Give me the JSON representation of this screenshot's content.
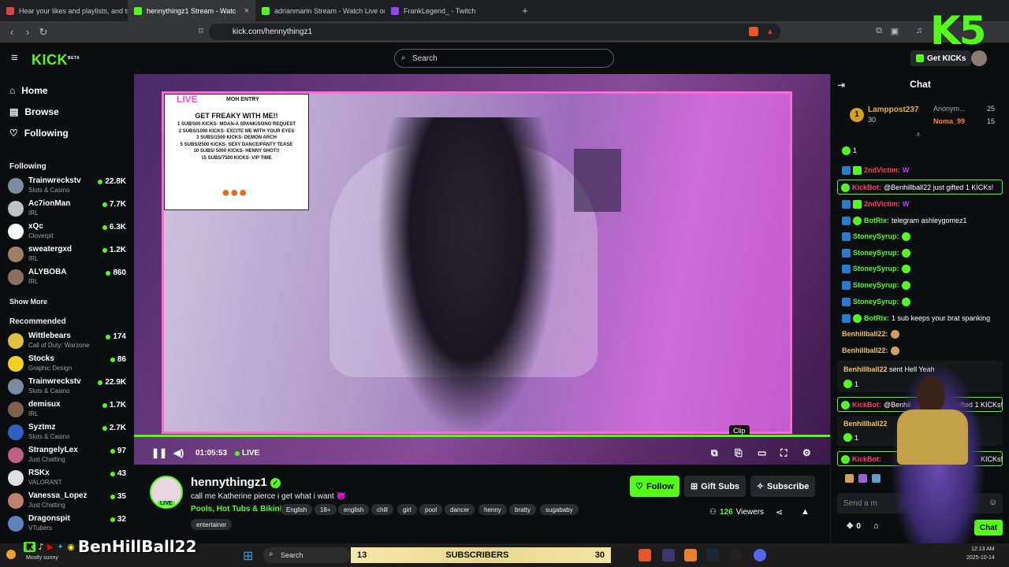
{
  "browser": {
    "tabs": [
      {
        "label": "Hear your likes and playlists, and tra",
        "color": "#d44"
      },
      {
        "label": "hennythingz1 Stream - Watc",
        "color": "#53fc18",
        "active": true
      },
      {
        "label": "adrianmarin Stream - Watch Live on",
        "color": "#53fc18"
      },
      {
        "label": "FrankLegend_ - Twitch",
        "color": "#9146ff"
      }
    ],
    "new_tab": "+",
    "url": "kick.com/hennythingz1"
  },
  "header": {
    "logo": "KICK",
    "logo_beta": "BETA",
    "search_placeholder": "Search",
    "get_kicks": "Get KICKs"
  },
  "sidebar": {
    "nav": [
      "Home",
      "Browse",
      "Following"
    ],
    "following_heading": "Following",
    "following": [
      {
        "name": "Trainwreckstv",
        "category": "Slots & Casino",
        "viewers": "22.8K",
        "color": "#7a8ca0"
      },
      {
        "name": "Ac7ionMan",
        "category": "IRL",
        "viewers": "7.7K",
        "color": "#c0c0c0"
      },
      {
        "name": "xQc",
        "category": "Cloverpit",
        "viewers": "6.3K",
        "color": "#fff"
      },
      {
        "name": "sweatergxd",
        "category": "IRL",
        "viewers": "1.2K",
        "color": "#a08060"
      },
      {
        "name": "ALYBOBA",
        "category": "IRL",
        "viewers": "860",
        "color": "#8a7060"
      }
    ],
    "show_more": "Show More",
    "recommended_heading": "Recommended",
    "recommended": [
      {
        "name": "Wittlebears",
        "category": "Call of Duty: Warzone",
        "viewers": "174",
        "color": "#e0c040"
      },
      {
        "name": "Stocks",
        "category": "Graphic Design",
        "viewers": "86",
        "color": "#f0d020"
      },
      {
        "name": "Trainwreckstv",
        "category": "Slots & Casino",
        "viewers": "22.9K",
        "color": "#7a8ca0"
      },
      {
        "name": "demisux",
        "category": "IRL",
        "viewers": "1.7K",
        "color": "#806050"
      },
      {
        "name": "Syztmz",
        "category": "Slots & Casino",
        "viewers": "2.7K",
        "color": "#3060c0"
      },
      {
        "name": "StrangelyLex",
        "category": "Just Chatting",
        "viewers": "97",
        "color": "#c06080"
      },
      {
        "name": "RSKx",
        "category": "VALORANT",
        "viewers": "43",
        "color": "#e0e0e0"
      },
      {
        "name": "Vanessa_Lopez",
        "category": "Just Chatting",
        "viewers": "35",
        "color": "#c08070"
      },
      {
        "name": "Dragonspit",
        "category": "VTubers",
        "viewers": "32",
        "color": "#6080c0"
      }
    ]
  },
  "player": {
    "live_label": "LIVE",
    "sign_corner": "MOH ENTRY",
    "sign_title": "GET FREAKY WITH ME!!",
    "sign_lines": [
      "1 SUB/500 KICKS- MOAN-A SPANK/SONG REQUEST",
      "2 SUBS/1000 KICKS- EXCITE ME WITH YOUR EYES",
      "3 SUBS/1500 KICKS- DEMON ARCH",
      "5 SUBS/2500 KICKS- SEXY DANCE/PANTY TEASE",
      "10 SUBS/ 5000 KICKS- HENNY SHOT!!",
      "15 SUBS/7500 KICKS- VIP TIME"
    ],
    "time": "01:05:53",
    "live_status": "LIVE",
    "clip_tooltip": "Clip"
  },
  "stream": {
    "name": "hennythingz1",
    "title": "call me Katherine pierce i get what i want 👿",
    "category": "Pools, Hot Tubs & Bikinis",
    "avatar_live": "LIVE",
    "tags": [
      "English",
      "18+",
      "english",
      "chill",
      "girl",
      "pool",
      "dancer",
      "henny",
      "bratty",
      "sugababy",
      "entertainer"
    ],
    "follow": "Follow",
    "gift_subs": "Gift Subs",
    "subscribe": "Subscribe",
    "viewers": "126",
    "viewers_label": "Viewers"
  },
  "chat": {
    "title": "Chat",
    "leader": {
      "name": "Lamppost237",
      "count": "30",
      "rank": "1"
    },
    "leader2": [
      {
        "name": "Anonym...",
        "count": "25"
      },
      {
        "name": "Noma_99",
        "count": "15"
      }
    ],
    "messages": [
      {
        "user": "",
        "text": "1",
        "color": "#fff"
      },
      {
        "user": "2ndVictim:",
        "text": "W",
        "color": "#ff4060"
      },
      {
        "user": "KickBot:",
        "text": "@Benhillball22 just gifted 1 KICKs!",
        "color": "#ff4060",
        "boxed": true
      },
      {
        "user": "2ndVictim:",
        "text": "W",
        "color": "#ff4060"
      },
      {
        "user": "BotRix:",
        "text": "telegram ashleygomez1",
        "color": "#53fc18"
      },
      {
        "user": "StoneySyrup:",
        "text": "",
        "color": "#53fc18"
      },
      {
        "user": "StoneySyrup:",
        "text": "",
        "color": "#53fc18"
      },
      {
        "user": "StoneySyrup:",
        "text": "",
        "color": "#53fc18"
      },
      {
        "user": "StoneySyrup:",
        "text": "",
        "color": "#53fc18"
      },
      {
        "user": "StoneySyrup:",
        "text": "",
        "color": "#53fc18"
      },
      {
        "user": "BotRix:",
        "text": "1 sub keeps your brat spanking",
        "color": "#53fc18"
      },
      {
        "user": "Benhillball22:",
        "text": "",
        "color": "#f0c060"
      },
      {
        "user": "Benhillball22:",
        "text": "",
        "color": "#f0c060"
      }
    ],
    "gift_card_1": {
      "user": "Benhillball22",
      "text": "sent Hell Yeah",
      "count": "1"
    },
    "kickbot_2": {
      "user": "KickBot:",
      "text": "@Benhil",
      "text2": "gifted 1 KICKs!"
    },
    "gift_card_2": {
      "user": "Benhillball22",
      "count": "1"
    },
    "kickbot_3": {
      "user": "KickBot:",
      "text": "KICKs!"
    },
    "input_placeholder": "Send a m",
    "send": "Chat",
    "kicks_count": "0"
  },
  "taskbar": {
    "weather": "Mostly sunny",
    "search": "Search",
    "subs_count": "13",
    "subs_label": "SUBSCRIBERS",
    "subs_right": "30",
    "time": "12:13 AM",
    "date": "2025-10-14"
  },
  "overlay": {
    "handle": "BenHillBall22",
    "badge_k": "K",
    "badge_5": "5"
  }
}
